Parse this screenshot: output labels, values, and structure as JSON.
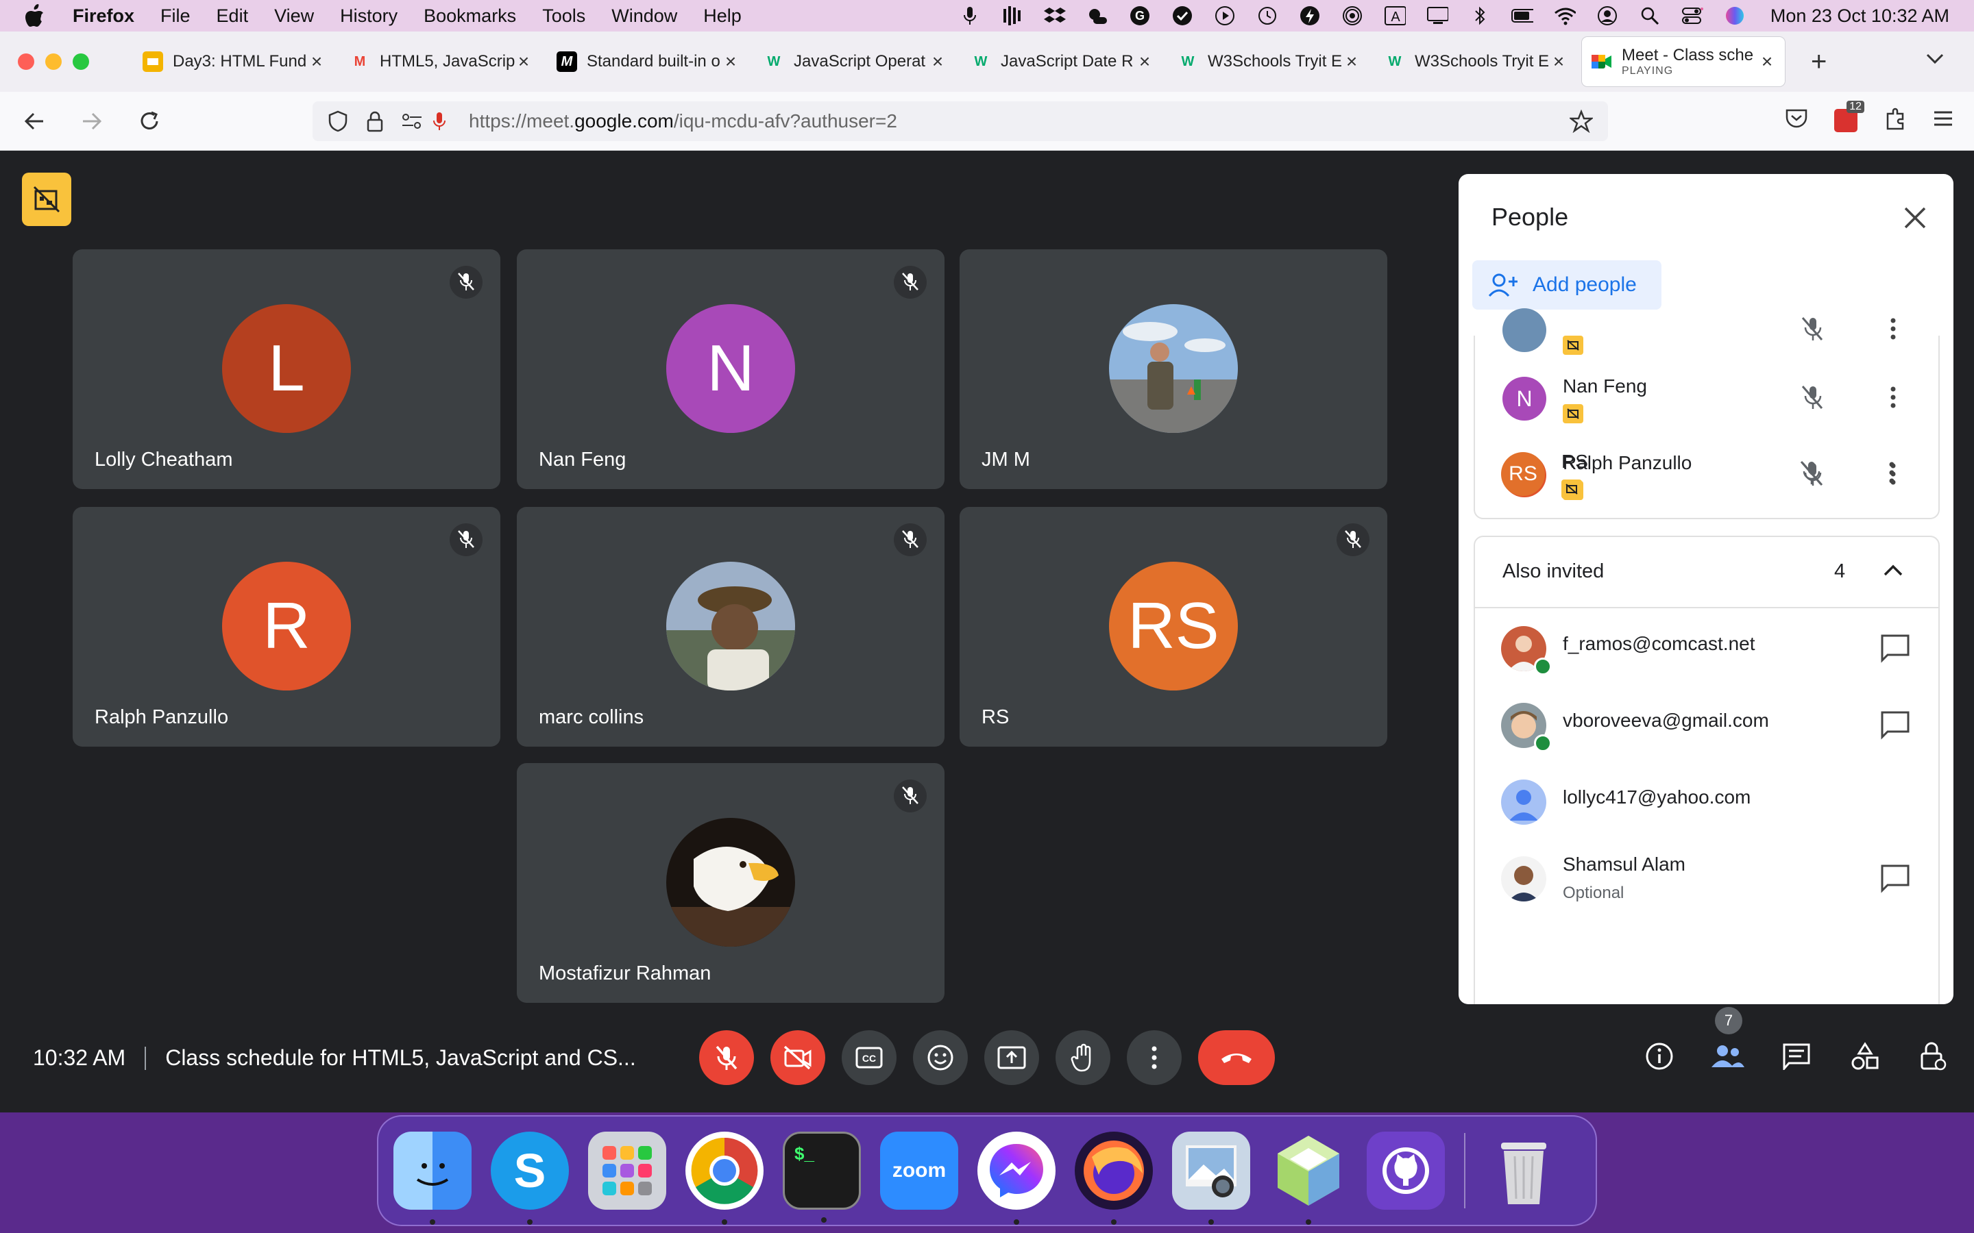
{
  "menubar": {
    "app": "Firefox",
    "items": [
      "File",
      "Edit",
      "View",
      "History",
      "Bookmarks",
      "Tools",
      "Window",
      "Help"
    ],
    "clock": "Mon 23 Oct  10:32 AM"
  },
  "tabs": [
    {
      "title": "Day3: HTML Fund",
      "icon": "slides-icon",
      "color": "#f4b400"
    },
    {
      "title": "HTML5, JavaScrip",
      "icon": "gmail-icon",
      "color": "#ea4335"
    },
    {
      "title": "Standard built-in o",
      "icon": "mdn-icon",
      "color": "#000000"
    },
    {
      "title": "JavaScript Operat",
      "icon": "w3schools-icon",
      "color": "#04aa6d"
    },
    {
      "title": "JavaScript Date R",
      "icon": "w3schools-icon",
      "color": "#04aa6d"
    },
    {
      "title": "W3Schools Tryit E",
      "icon": "w3schools-icon",
      "color": "#04aa6d"
    },
    {
      "title": "W3Schools Tryit E",
      "icon": "w3schools-icon",
      "color": "#04aa6d"
    }
  ],
  "active_tab": {
    "title": "Meet - Class sche",
    "sub": "PLAYING"
  },
  "url": {
    "prefix": "https://meet.",
    "domain": "google.com",
    "path": "/iqu-mcdu-afv?authuser=2"
  },
  "extension_badge": "12",
  "tiles": [
    {
      "name": "Lolly Cheatham",
      "initial": "L",
      "color": "#b5401f",
      "photo": false
    },
    {
      "name": "Nan Feng",
      "initial": "N",
      "color": "#a849b8",
      "photo": false
    },
    {
      "name": "JM M",
      "initial": "",
      "color": "#6b8fb3",
      "photo": true
    },
    {
      "name": "Ralph Panzullo",
      "initial": "R",
      "color": "#e0532b",
      "photo": false
    },
    {
      "name": "marc collins",
      "initial": "",
      "color": "#7b6a55",
      "photo": true
    },
    {
      "name": "RS",
      "initial": "RS",
      "color": "#e2702b",
      "photo": false
    },
    {
      "name": "Mostafizur Rahman",
      "initial": "",
      "color": "#3b2c22",
      "photo": true
    }
  ],
  "panel": {
    "title": "People",
    "add_label": "Add people",
    "participants": [
      {
        "name": "Nan Feng",
        "initial": "N",
        "color": "#a849b8"
      },
      {
        "name": "Ralph Panzullo",
        "initial": "R",
        "color": "#e0532b"
      },
      {
        "name": "RS",
        "initial": "RS",
        "color": "#e2702b"
      }
    ],
    "invited_label": "Also invited",
    "invited_count": "4",
    "invited": [
      {
        "name": "f_ramos@comcast.net",
        "sub": "",
        "checked": true
      },
      {
        "name": "vboroveeva@gmail.com",
        "sub": "",
        "checked": true
      },
      {
        "name": "lollyc417@yahoo.com",
        "sub": "",
        "checked": false
      },
      {
        "name": "Shamsul Alam",
        "sub": "Optional",
        "checked": false
      }
    ]
  },
  "bottom": {
    "time": "10:32 AM",
    "meeting_title": "Class schedule for HTML5, JavaScript and CS...",
    "people_count": "7"
  },
  "dock": [
    {
      "name": "finder-icon",
      "label": "",
      "color": "#3d8df5"
    },
    {
      "name": "skype-icon",
      "label": "S",
      "color": "#1b9cea"
    },
    {
      "name": "launchpad-icon",
      "label": "",
      "color": "#d0d3da"
    },
    {
      "name": "chrome-icon",
      "label": "",
      "color": "#ffffff"
    },
    {
      "name": "terminal-icon",
      "label": "$_",
      "color": "#1b1b1b"
    },
    {
      "name": "zoom-icon",
      "label": "zoom",
      "color": "#2d8cff"
    },
    {
      "name": "messenger-icon",
      "label": "",
      "color": "#ffffff"
    },
    {
      "name": "firefox-icon",
      "label": "",
      "color": "#20123a"
    },
    {
      "name": "preview-icon",
      "label": "",
      "color": "#c9d7e6"
    },
    {
      "name": "netbeans-icon",
      "label": "",
      "color": "#a5d66b"
    },
    {
      "name": "github-icon",
      "label": "",
      "color": "#6e40c9"
    },
    {
      "name": "trash-icon",
      "label": "",
      "color": "#d9d9dc"
    }
  ]
}
